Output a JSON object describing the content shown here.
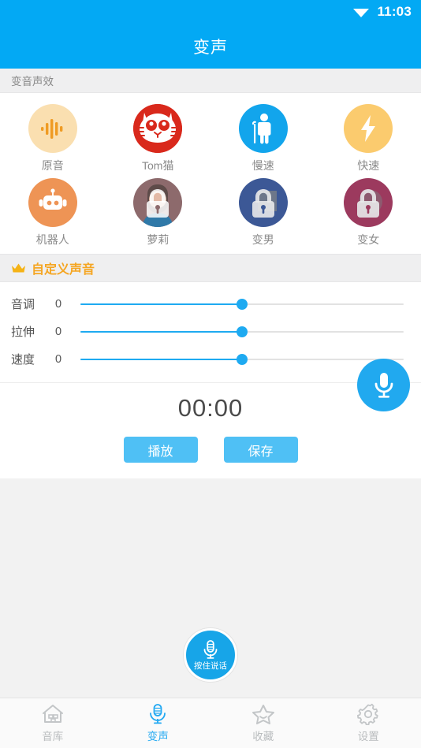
{
  "status_bar": {
    "time": "11:03",
    "wifi_icon": "wifi-icon"
  },
  "app_bar": {
    "title": "变声"
  },
  "effects_section": {
    "header": "变音声效",
    "items": [
      {
        "label": "原音",
        "icon": "waveform-icon",
        "bg": "#fadfb0",
        "locked": false
      },
      {
        "label": "Tom猫",
        "icon": "cat-face-icon",
        "bg": "#d9291c",
        "locked": false
      },
      {
        "label": "慢速",
        "icon": "elderly-man-icon",
        "bg": "#12a5ec",
        "locked": false
      },
      {
        "label": "快速",
        "icon": "lightning-icon",
        "bg": "#fbcb6e",
        "locked": false
      },
      {
        "label": "机器人",
        "icon": "robot-icon",
        "bg": "#ee9455",
        "locked": false
      },
      {
        "label": "萝莉",
        "icon": "lock-icon",
        "bg": "#8d6a6c",
        "locked": true
      },
      {
        "label": "变男",
        "icon": "lock-icon",
        "bg": "#3c5896",
        "locked": true
      },
      {
        "label": "变女",
        "icon": "lock-icon",
        "bg": "#9c3a5e",
        "locked": true
      }
    ]
  },
  "custom_section": {
    "header": "自定义声音",
    "crown_icon": "crown-icon",
    "sliders": [
      {
        "name": "音调",
        "value": "0",
        "percent": 50
      },
      {
        "name": "拉伸",
        "value": "0",
        "percent": 50
      },
      {
        "name": "速度",
        "value": "0",
        "percent": 50
      }
    ]
  },
  "recorder": {
    "timer": "00:00",
    "play_label": "播放",
    "save_label": "保存",
    "fab_icon": "microphone-icon"
  },
  "push_to_talk": {
    "label": "按住说话",
    "icon": "microphone-icon"
  },
  "bottom_nav": {
    "items": [
      {
        "label": "音库",
        "icon": "home-icon",
        "active": false
      },
      {
        "label": "变声",
        "icon": "microphone-icon",
        "active": true
      },
      {
        "label": "收藏",
        "icon": "star-icon",
        "active": false
      },
      {
        "label": "设置",
        "icon": "gear-icon",
        "active": false
      }
    ]
  },
  "colors": {
    "primary": "#03a9f4",
    "accent_gold": "#f5a623",
    "page_bg": "#f2f2f2",
    "card_bg": "#ffffff"
  }
}
